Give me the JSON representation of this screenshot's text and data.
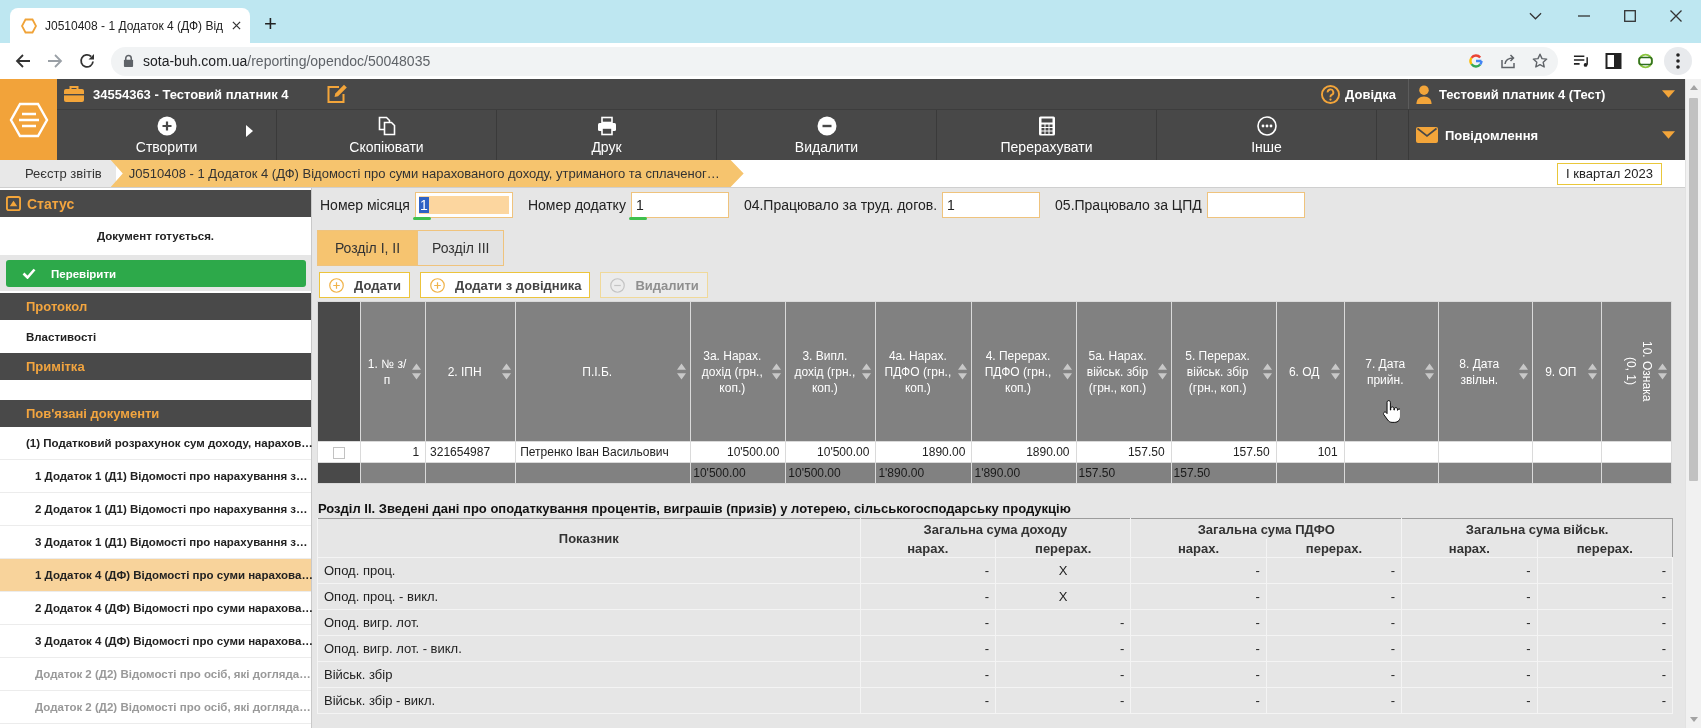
{
  "browser": {
    "tab": {
      "title": "J0510408 - 1 Додаток 4 (ДФ) Від"
    },
    "new_tab": "+",
    "url": {
      "domain": "sota-buh.com.ua",
      "path": "/reporting/opendoc/50048035"
    }
  },
  "header": {
    "company": "34554363 - Тестовий платник 4",
    "help": "Довідка",
    "user": "Тестовий платник 4 (Тест)",
    "messages": "Повідомлення",
    "toolbar": [
      {
        "label": "Створити",
        "submenu": true
      },
      {
        "label": "Скопіювати",
        "submenu": false
      },
      {
        "label": "Друк",
        "submenu": false
      },
      {
        "label": "Видалити",
        "submenu": false
      },
      {
        "label": "Перерахувати",
        "submenu": false
      },
      {
        "label": "Інше",
        "submenu": false
      }
    ]
  },
  "breadcrumb": [
    {
      "label": "Реєстр звітів",
      "selected": false
    },
    {
      "label": "J0510408 - 1 Додаток 4 (ДФ) Відомості про суми нарахованого доходу, утриманого та сплаченог…",
      "selected": true
    }
  ],
  "period": "I квартал 2023",
  "sidebar": {
    "status": {
      "title": "Статус",
      "expanded": true,
      "message": "Документ готується.",
      "check_button": "Перевірити"
    },
    "protocol": "Протокол",
    "properties": "Властивості",
    "note": "Примітка",
    "related": {
      "title": "Пов'язані документи",
      "items": [
        {
          "label": "(1) Податковий розрахунок сум доходу, нарахов…",
          "selected": false,
          "disabled": false,
          "children": [
            {
              "label": "1 Додаток 1 (Д1) Відомості про нарахування з…",
              "selected": false,
              "disabled": false
            },
            {
              "label": "2 Додаток 1 (Д1) Відомості про нарахування з…",
              "selected": false,
              "disabled": false
            },
            {
              "label": "3 Додаток 1 (Д1) Відомості про нарахування з…",
              "selected": false,
              "disabled": false
            },
            {
              "label": "1 Додаток 4 (ДФ) Відомості про суми нарахова…",
              "selected": true,
              "disabled": false
            },
            {
              "label": "2 Додаток 4 (ДФ) Відомості про суми нарахова…",
              "selected": false,
              "disabled": false
            },
            {
              "label": "3 Додаток 4 (ДФ) Відомості про суми нарахова…",
              "selected": false,
              "disabled": false
            },
            {
              "label": "Додаток 2 (Д2) Відомості про осіб, які догляда…",
              "selected": false,
              "disabled": true
            },
            {
              "label": "Додаток 2 (Д2) Відомості про осіб, які догляда…",
              "selected": false,
              "disabled": true
            }
          ]
        }
      ]
    }
  },
  "fields": [
    {
      "label": "Номер місяця",
      "value": "1",
      "focused": true,
      "underlined": true
    },
    {
      "label": "Номер додатку",
      "value": "1",
      "focused": false,
      "underlined": true
    },
    {
      "label": "04.Працювало за труд. догов.",
      "value": "1",
      "focused": false,
      "underlined": false
    },
    {
      "label": "05.Працювало за ЦПД",
      "focused": false,
      "underlined": false
    }
  ],
  "tabs": [
    {
      "label": "Розділ I, II",
      "selected": true
    },
    {
      "label": "Розділ III",
      "selected": false
    }
  ],
  "actions": [
    {
      "label": "Додати",
      "kind": "add",
      "disabled": false
    },
    {
      "label": "Додати з довідника",
      "kind": "add",
      "disabled": false
    },
    {
      "label": "Видалити",
      "kind": "remove",
      "disabled": true
    }
  ],
  "table": {
    "columns": [
      {
        "label": "1. № з/п",
        "rotated": false
      },
      {
        "label": "2. ІПН",
        "rotated": false
      },
      {
        "label": "П.І.Б.",
        "rotated": false
      },
      {
        "label": "3а. Нарах. дохід (грн., коп.)",
        "rotated": false,
        "total": "10'500.00"
      },
      {
        "label": "3. Випл. дохід (грн., коп.)",
        "rotated": false,
        "total": "10'500.00"
      },
      {
        "label": "4а. Нарах. ПДФО (грн., коп.)",
        "rotated": false,
        "total": "1'890.00"
      },
      {
        "label": "4. Перерах. ПДФО (грн., коп.)",
        "rotated": false,
        "total": "1'890.00"
      },
      {
        "label": "5а. Нарах. військ. збір (грн., коп.)",
        "rotated": false,
        "total": "157.50"
      },
      {
        "label": "5. Перерах. військ. збір (грн., коп.)",
        "rotated": false,
        "total": "157.50"
      },
      {
        "label": "6. ОД",
        "rotated": false
      },
      {
        "label": "7. Дата прийн.",
        "rotated": false
      },
      {
        "label": "8. Дата звільн.",
        "rotated": false
      },
      {
        "label": "9. ОП",
        "rotated": false
      },
      {
        "label": "10. Ознака (0, 1)",
        "rotated": true
      }
    ],
    "rows": [
      {
        "checked": false,
        "cells": [
          "1",
          "321654987",
          "Петренко Іван Васильович",
          "10'500.00",
          "10'500.00",
          "1890.00",
          "1890.00",
          "157.50",
          "157.50",
          "101"
        ]
      }
    ]
  },
  "section_2": {
    "title": "Розділ II. Зведені дані про оподаткування процентів, виграшів (призів) у лотерею, сільськогосподарську продукцію",
    "indicator_header": "Показник",
    "groups": [
      {
        "label": "Загальна сума доходу",
        "subcolumns": [
          "нарах.",
          "перерах."
        ]
      },
      {
        "label": "Загальна сума ПДФО",
        "subcolumns": [
          "нарах.",
          "перерах."
        ]
      },
      {
        "label": "Загальна сума військ.",
        "subcolumns": [
          "нарах.",
          "перерах."
        ]
      }
    ],
    "rows": [
      {
        "label": "Опод. проц.",
        "values": [
          {
            "text": "-",
            "kind": "amount"
          },
          {
            "text": "X",
            "kind": "mark"
          },
          {
            "text": "-",
            "kind": "amount"
          },
          {
            "text": "-",
            "kind": "amount"
          },
          {
            "text": "-",
            "kind": "amount"
          },
          {
            "text": "-",
            "kind": "amount"
          }
        ]
      },
      {
        "label": "Опод. проц. - викл.",
        "values": [
          {
            "text": "-",
            "kind": "amount"
          },
          {
            "text": "X",
            "kind": "mark"
          },
          {
            "text": "-",
            "kind": "amount"
          },
          {
            "text": "-",
            "kind": "amount"
          },
          {
            "text": "-",
            "kind": "amount"
          },
          {
            "text": "-",
            "kind": "amount"
          }
        ]
      },
      {
        "label": "Опод. вигр. лот.",
        "values": [
          {
            "text": "-",
            "kind": "amount"
          },
          {
            "text": "-",
            "kind": "amount"
          },
          {
            "text": "-",
            "kind": "amount"
          },
          {
            "text": "-",
            "kind": "amount"
          },
          {
            "text": "-",
            "kind": "amount"
          },
          {
            "text": "-",
            "kind": "amount"
          }
        ]
      },
      {
        "label": "Опод. вигр. лот. - викл.",
        "values": [
          {
            "text": "-",
            "kind": "amount"
          },
          {
            "text": "-",
            "kind": "amount"
          },
          {
            "text": "-",
            "kind": "amount"
          },
          {
            "text": "-",
            "kind": "amount"
          },
          {
            "text": "-",
            "kind": "amount"
          },
          {
            "text": "-",
            "kind": "amount"
          }
        ]
      },
      {
        "label": "Військ. збір",
        "values": [
          {
            "text": "-",
            "kind": "amount"
          },
          {
            "text": "-",
            "kind": "amount"
          },
          {
            "text": "-",
            "kind": "amount"
          },
          {
            "text": "-",
            "kind": "amount"
          },
          {
            "text": "-",
            "kind": "amount"
          },
          {
            "text": "-",
            "kind": "amount"
          }
        ]
      },
      {
        "label": "Військ. збір - викл.",
        "values": [
          {
            "text": "-",
            "kind": "amount"
          },
          {
            "text": "-",
            "kind": "amount"
          },
          {
            "text": "-",
            "kind": "amount"
          },
          {
            "text": "-",
            "kind": "amount"
          },
          {
            "text": "-",
            "kind": "amount"
          },
          {
            "text": "-",
            "kind": "amount"
          }
        ]
      }
    ]
  }
}
